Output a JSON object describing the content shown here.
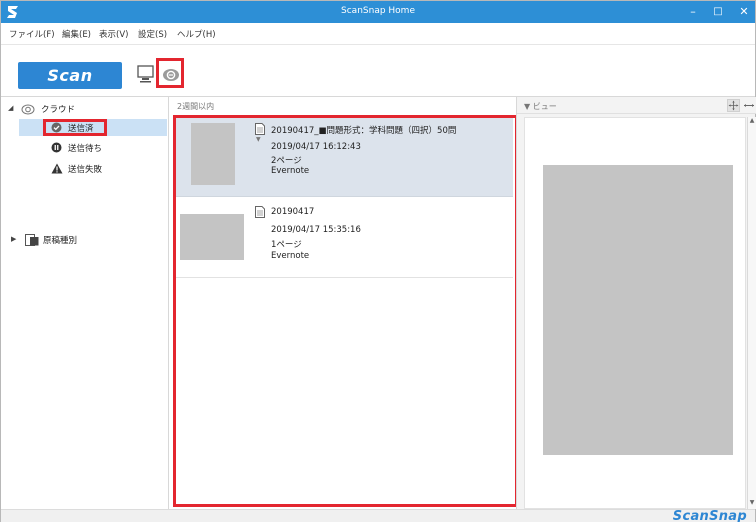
{
  "window": {
    "title": "ScanSnap Home",
    "min_glyph": "–",
    "max_glyph": "□",
    "close_glyph": "✕"
  },
  "menu": {
    "items": [
      "ファイル(F)",
      "編集(E)",
      "表示(V)",
      "設定(S)",
      "ヘルプ(H)"
    ]
  },
  "toolbar": {
    "scan_label": "Scan"
  },
  "sidebar": {
    "cloud_label": "クラウド",
    "items": [
      {
        "label": "送信済",
        "icon": "check-circle-icon"
      },
      {
        "label": "送信待ち",
        "icon": "pause-circle-icon"
      },
      {
        "label": "送信失敗",
        "icon": "warning-icon"
      }
    ],
    "doc_type_label": "原稿種別"
  },
  "list": {
    "section_title": "2週間以内",
    "entries": [
      {
        "title": "20190417_■問題形式：学科問題（四択）50問",
        "date": "2019/04/17 16:12:43",
        "pages": "2ページ",
        "destination": "Evernote"
      },
      {
        "title": "20190417",
        "date": "2019/04/17 15:35:16",
        "pages": "1ページ",
        "destination": "Evernote"
      }
    ]
  },
  "viewer": {
    "label": "▼ ビュー"
  },
  "footer": {
    "brand": "ScanSnap"
  },
  "colors": {
    "accent": "#2d86d3",
    "highlight_box": "#e3262f",
    "selection": "#cbe1f5"
  }
}
